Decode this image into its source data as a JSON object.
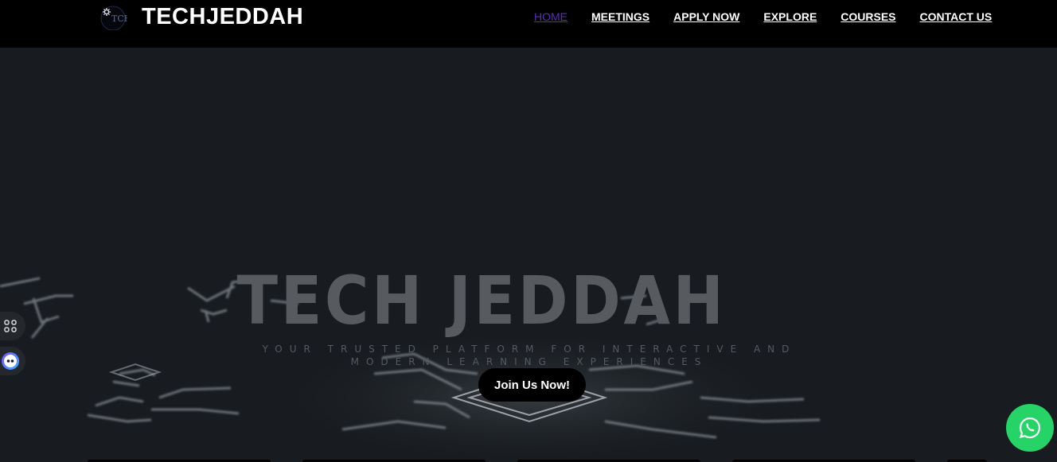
{
  "header": {
    "brand": "TECHJEDDAH",
    "nav": [
      {
        "label": "HOME",
        "active": true
      },
      {
        "label": "MEETINGS",
        "active": false
      },
      {
        "label": "APPLY NOW",
        "active": false
      },
      {
        "label": "EXPLORE",
        "active": false
      },
      {
        "label": "COURSES",
        "active": false
      },
      {
        "label": "CONTACT US",
        "active": false
      }
    ]
  },
  "hero": {
    "title": "TECH JEDDAH",
    "subtitle": "YOUR TRUSTED PLATFORM FOR INTERACTIVE AND MODERN LEARNING EXPERIENCES",
    "cta_label": "Join Us Now!"
  },
  "icons": {
    "logo": "techjeddah-logo-icon",
    "apps": "apps-grid-icon",
    "chat": "chat-assistant-icon",
    "whatsapp": "whatsapp-icon"
  },
  "colors": {
    "header_bg": "#000000",
    "hero_bg": "#181c20",
    "active_nav": "#5b2bbd",
    "whatsapp": "#25d366"
  }
}
